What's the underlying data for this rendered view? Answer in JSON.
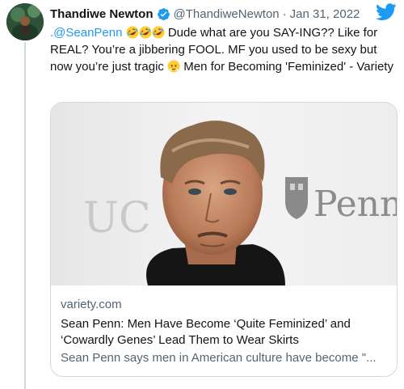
{
  "tweet": {
    "author_name": "Thandiwe Newton",
    "author_handle": "@ThandiweNewton",
    "separator": "·",
    "date": "Jan 31, 2022",
    "mention": ".@SeanPenn",
    "text_part1": "Dude what are you SAY-ING?? Like for REAL? You’re a jibbering FOOL. MF you used to be sexy but now you’re just tragic",
    "text_part2": "Men for Becoming 'Feminized' - Variety",
    "emojis": [
      "rolling-on-floor-laughing-emoji",
      "rolling-on-floor-laughing-emoji",
      "rolling-on-floor-laughing-emoji",
      "face-with-steam-emoji"
    ],
    "accent_color": "#1d9bf0"
  },
  "card": {
    "domain": "variety.com",
    "title": "Sean Penn: Men Have Become ‘Quite Feminized’ and ‘Cowardly Genes’ Lead Them to Wear Skirts",
    "description": "Sean Penn says men in American culture have become \"...",
    "image_backdrop_text": "Penn",
    "image_backdrop_text_left": "UC"
  }
}
